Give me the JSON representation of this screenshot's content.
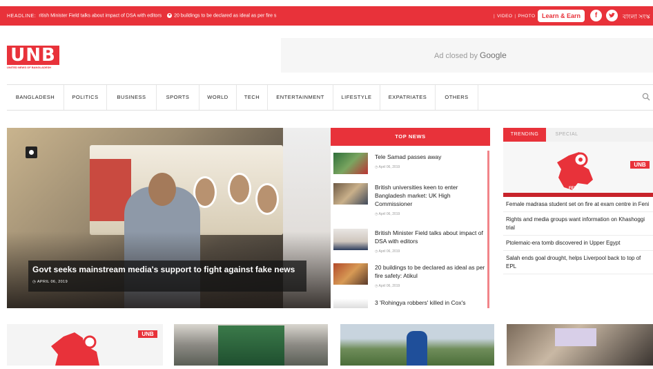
{
  "topbar": {
    "headline_label": "HEADLINE:",
    "ticker_1": "ritish Minister Field talks about impact of DSA with editors",
    "ticker_2": "20 buildings to be declared as ideal as per fire s",
    "video": "VIDEO",
    "photo": "PHOTO",
    "learn_earn": "Learn & Earn",
    "facebook": "f",
    "twitter": "t",
    "lang": "বাংলা সংস্ক",
    "accent": "#e8323a"
  },
  "logo": {
    "text": "UNB",
    "sub": "UNITED NEWS OF BANGLADESH"
  },
  "ad": {
    "text": "Ad closed by",
    "brand": "Google"
  },
  "nav": {
    "items": [
      "BANGLADESH",
      "POLITICS",
      "BUSINESS",
      "SPORTS",
      "WORLD",
      "TECH",
      "ENTERTAINMENT",
      "LIFESTYLE",
      "EXPATRIATES",
      "OTHERS"
    ]
  },
  "hero": {
    "title": "Govt seeks mainstream media's support to fight against fake news",
    "date": "APRIL 06, 2019"
  },
  "top_news": {
    "header": "TOP NEWS",
    "items": [
      {
        "title": "Tele Samad passes away",
        "date": "April 06, 2019"
      },
      {
        "title": "British universities keen to enter Bangladesh market: UK High Commissioner",
        "date": "April 06, 2019"
      },
      {
        "title": "British Minister Field talks about impact of DSA with editors",
        "date": "April 06, 2019"
      },
      {
        "title": "20 buildings to be declared as ideal as per fire safety: Atikul",
        "date": "April 06, 2019"
      },
      {
        "title": "3 'Rohingya robbers' killed in Cox's",
        "date": ""
      }
    ]
  },
  "trending": {
    "tab_trending": "TRENDING",
    "tab_special": "SPECIAL",
    "map_label": "FENI",
    "map_logo": "UNB",
    "items": [
      "Female madrasa student set on fire at exam centre in Feni",
      "Rights and media groups want information on Khashoggi trial",
      "Ptolemaic-era tomb discovered in Upper Egypt",
      "Salah ends goal drought, helps Liverpool back to top of EPL"
    ]
  },
  "thumb_logo": "UNB"
}
